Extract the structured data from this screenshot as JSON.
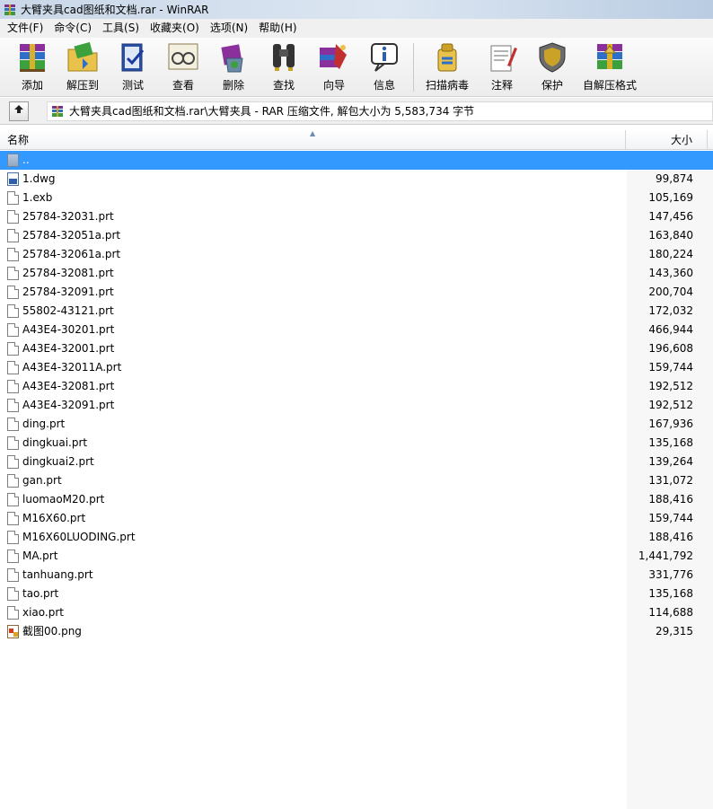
{
  "window": {
    "title": "大臂夹具cad图纸和文档.rar - WinRAR"
  },
  "menu": [
    "文件(F)",
    "命令(C)",
    "工具(S)",
    "收藏夹(O)",
    "选项(N)",
    "帮助(H)"
  ],
  "toolbar": [
    {
      "label": "添加",
      "icon": "add-archive-icon"
    },
    {
      "label": "解压到",
      "icon": "extract-to-icon"
    },
    {
      "label": "测试",
      "icon": "test-icon"
    },
    {
      "label": "查看",
      "icon": "view-icon"
    },
    {
      "label": "删除",
      "icon": "delete-icon"
    },
    {
      "label": "查找",
      "icon": "find-icon"
    },
    {
      "label": "向导",
      "icon": "wizard-icon"
    },
    {
      "label": "信息",
      "icon": "info-icon"
    },
    {
      "label": "扫描病毒",
      "icon": "virus-scan-icon"
    },
    {
      "label": "注释",
      "icon": "comment-icon"
    },
    {
      "label": "保护",
      "icon": "protect-icon"
    },
    {
      "label": "自解压格式",
      "icon": "sfx-icon"
    }
  ],
  "address": {
    "path": "大臂夹具cad图纸和文档.rar\\大臂夹具 - RAR 压缩文件, 解包大小为 5,583,734 字节"
  },
  "columns": {
    "name": "名称",
    "size": "大小"
  },
  "files": [
    {
      "name": "..",
      "size": "",
      "type": "folder"
    },
    {
      "name": "1.dwg",
      "size": "99,874",
      "type": "dwg"
    },
    {
      "name": "1.exb",
      "size": "105,169",
      "type": "doc"
    },
    {
      "name": "25784-32031.prt",
      "size": "147,456",
      "type": "doc"
    },
    {
      "name": "25784-32051a.prt",
      "size": "163,840",
      "type": "doc"
    },
    {
      "name": "25784-32061a.prt",
      "size": "180,224",
      "type": "doc"
    },
    {
      "name": "25784-32081.prt",
      "size": "143,360",
      "type": "doc"
    },
    {
      "name": "25784-32091.prt",
      "size": "200,704",
      "type": "doc"
    },
    {
      "name": "55802-43121.prt",
      "size": "172,032",
      "type": "doc"
    },
    {
      "name": "A43E4-30201.prt",
      "size": "466,944",
      "type": "doc"
    },
    {
      "name": "A43E4-32001.prt",
      "size": "196,608",
      "type": "doc"
    },
    {
      "name": "A43E4-32011A.prt",
      "size": "159,744",
      "type": "doc"
    },
    {
      "name": "A43E4-32081.prt",
      "size": "192,512",
      "type": "doc"
    },
    {
      "name": "A43E4-32091.prt",
      "size": "192,512",
      "type": "doc"
    },
    {
      "name": "ding.prt",
      "size": "167,936",
      "type": "doc"
    },
    {
      "name": "dingkuai.prt",
      "size": "135,168",
      "type": "doc"
    },
    {
      "name": "dingkuai2.prt",
      "size": "139,264",
      "type": "doc"
    },
    {
      "name": "gan.prt",
      "size": "131,072",
      "type": "doc"
    },
    {
      "name": "luomaoM20.prt",
      "size": "188,416",
      "type": "doc"
    },
    {
      "name": "M16X60.prt",
      "size": "159,744",
      "type": "doc"
    },
    {
      "name": "M16X60LUODING.prt",
      "size": "188,416",
      "type": "doc"
    },
    {
      "name": "MA.prt",
      "size": "1,441,792",
      "type": "doc"
    },
    {
      "name": "tanhuang.prt",
      "size": "331,776",
      "type": "doc"
    },
    {
      "name": "tao.prt",
      "size": "135,168",
      "type": "doc"
    },
    {
      "name": "xiao.prt",
      "size": "114,688",
      "type": "doc"
    },
    {
      "name": "截图00.png",
      "size": "29,315",
      "type": "png"
    }
  ]
}
